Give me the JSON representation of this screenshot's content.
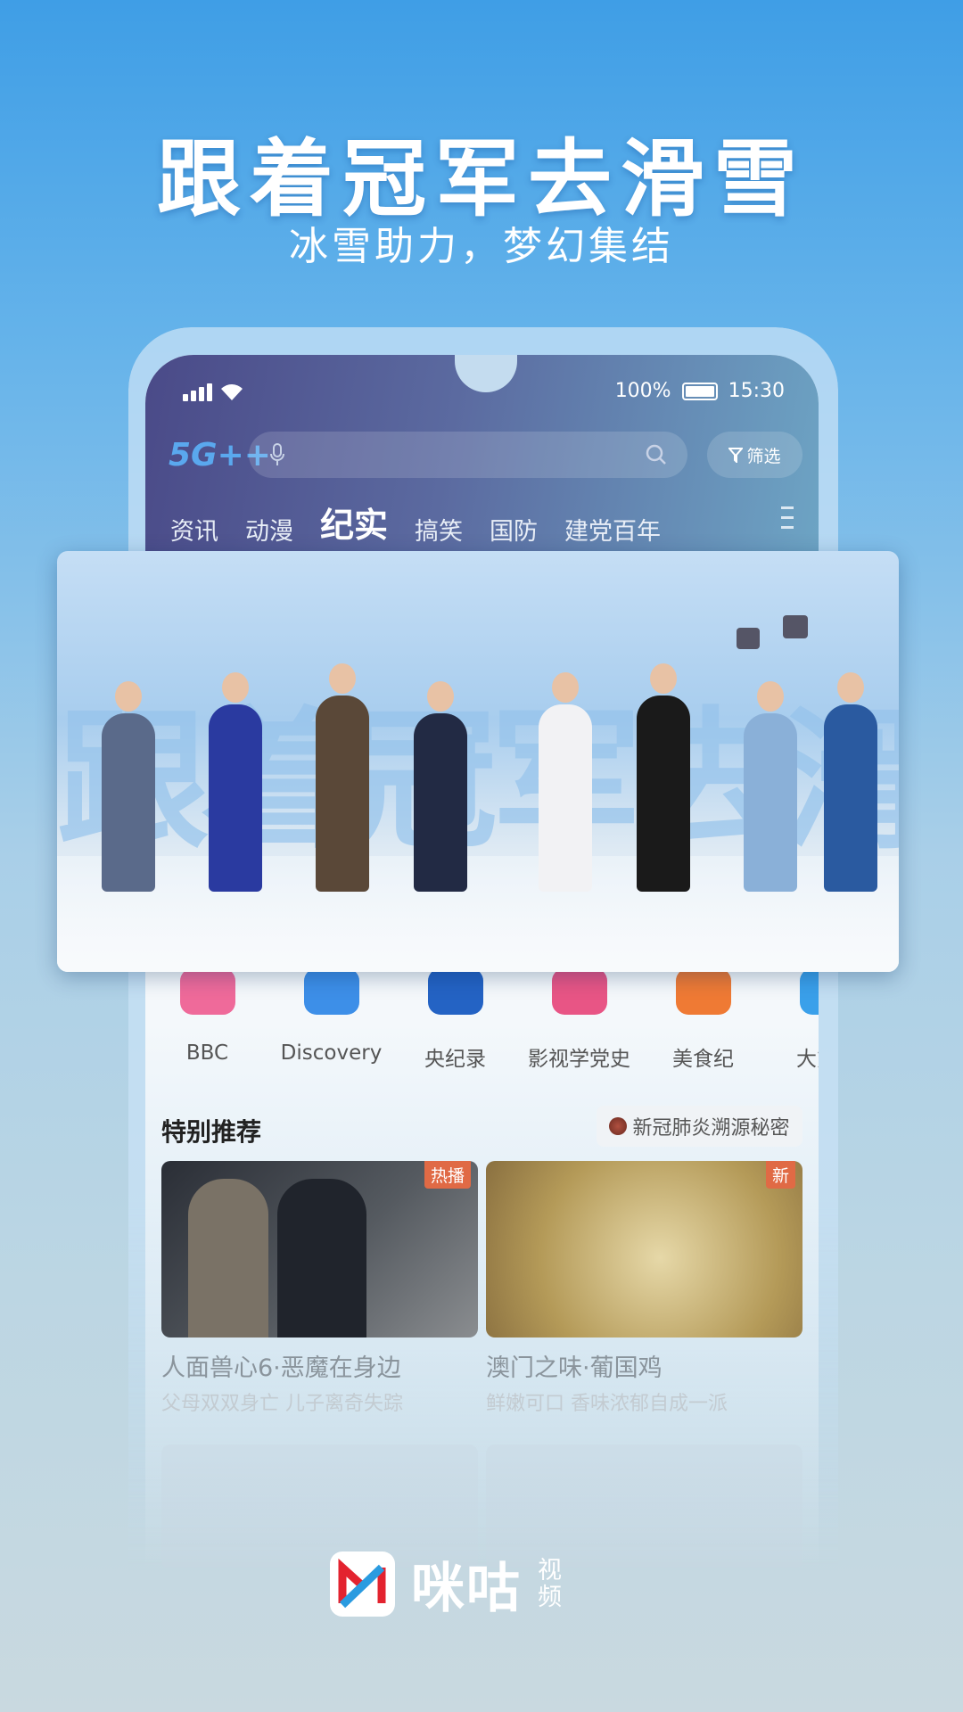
{
  "promo": {
    "headline": "跟着冠军去滑雪",
    "subline": "冰雪助力，梦幻集结"
  },
  "status": {
    "battery": "100%",
    "time": "15:30"
  },
  "header": {
    "logo": "5G++",
    "filter_label": "筛选",
    "search_placeholder": ""
  },
  "tabs": [
    {
      "label": "资讯"
    },
    {
      "label": "动漫"
    },
    {
      "label": "纪实",
      "active": true
    },
    {
      "label": "搞笑"
    },
    {
      "label": "国防"
    },
    {
      "label": "建党百年"
    }
  ],
  "banner": {
    "text": "跟着冠军去滑雪"
  },
  "categories": [
    {
      "label": "BBC",
      "color": "#ef6a9a"
    },
    {
      "label": "Discovery",
      "color": "#3d8fe8"
    },
    {
      "label": "央纪录",
      "color": "#2463c4"
    },
    {
      "label": "影视学党史",
      "color": "#e85585"
    },
    {
      "label": "美食纪",
      "color": "#ef7a34"
    },
    {
      "label": "大熊猫",
      "color": "#3aa0ea"
    }
  ],
  "section": {
    "title": "特别推荐",
    "tag": "新冠肺炎溯源秘密"
  },
  "cards": [
    {
      "badge": "热播",
      "title": "人面兽心6·恶魔在身边",
      "subtitle": "父母双双身亡 儿子离奇失踪"
    },
    {
      "badge": "新",
      "title": "澳门之味·葡国鸡",
      "subtitle": "鲜嫩可口 香味浓郁自成一派"
    }
  ],
  "brand": {
    "name": "咪咕",
    "sub": "视频",
    "accent_red": "#e3232f",
    "accent_blue": "#2a9be0"
  }
}
